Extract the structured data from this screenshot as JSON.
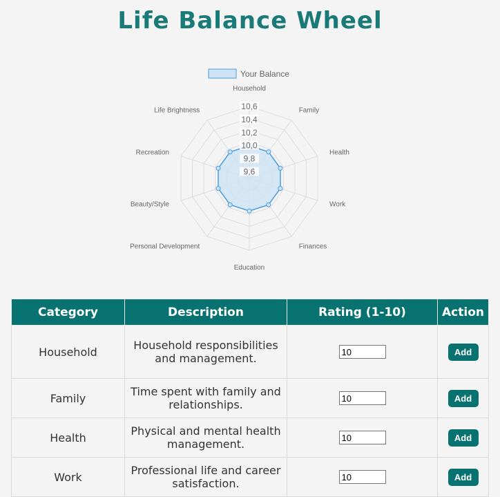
{
  "page": {
    "title": "Life Balance Wheel"
  },
  "chart_data": {
    "type": "radar",
    "categories": [
      "Household",
      "Family",
      "Health",
      "Work",
      "Finances",
      "Education",
      "Personal Development",
      "Beauty/Style",
      "Recreation",
      "Life Brightness"
    ],
    "series": [
      {
        "name": "Your Balance",
        "values": [
          10,
          10,
          10,
          10,
          10,
          10,
          10,
          10,
          10,
          10
        ]
      }
    ],
    "r_ticks": [
      "9,6",
      "9,8",
      "10,0",
      "10,2",
      "10,4",
      "10,6"
    ],
    "r_range": [
      9.5,
      10.6
    ],
    "legend_position": "top",
    "colors": {
      "fill": "#cfe3f5",
      "stroke": "#4a9de0",
      "grid": "#dddddd"
    }
  },
  "table": {
    "headers": [
      "Category",
      "Description",
      "Rating (1-10)",
      "Action"
    ],
    "rows": [
      {
        "category": "Household",
        "description": "Household responsibilities and management.",
        "rating": "10",
        "action": "Add"
      },
      {
        "category": "Family",
        "description": "Time spent with family and relationships.",
        "rating": "10",
        "action": "Add"
      },
      {
        "category": "Health",
        "description": "Physical and mental health management.",
        "rating": "10",
        "action": "Add"
      },
      {
        "category": "Work",
        "description": "Professional life and career satisfaction.",
        "rating": "10",
        "action": "Add"
      }
    ]
  }
}
